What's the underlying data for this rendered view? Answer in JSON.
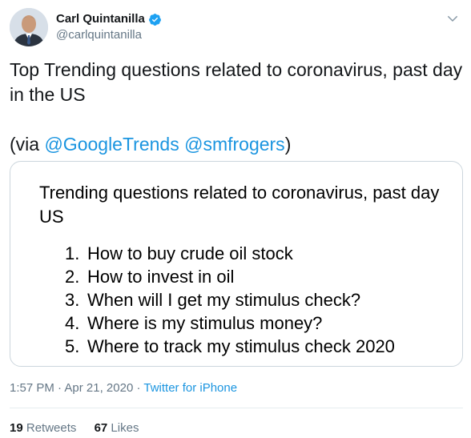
{
  "author": {
    "display_name": "Carl Quintanilla",
    "handle": "@carlquintanilla",
    "avatar_icon": "profile-photo",
    "verified_icon": "verified-badge-icon",
    "verified_color": "#1da1f2"
  },
  "tweet": {
    "text": "Top Trending questions related to coronavirus, past day in the US",
    "via_prefix": "(via ",
    "mention_1": "@GoogleTrends",
    "mention_2": "@smfrogers",
    "via_suffix": ")",
    "mention_color": "#1b95e0"
  },
  "card": {
    "title": "Trending questions related to coronavirus, past day US",
    "items": [
      {
        "num": "1.",
        "text": "How to buy crude oil stock"
      },
      {
        "num": "2.",
        "text": "How to invest in oil"
      },
      {
        "num": "3.",
        "text": "When will I get my stimulus check?"
      },
      {
        "num": "4.",
        "text": "Where is my stimulus money?"
      },
      {
        "num": "5.",
        "text": "Where to track my stimulus check 2020"
      }
    ]
  },
  "meta": {
    "time": "1:57 PM",
    "separator": " · ",
    "date": "Apr 21, 2020",
    "separator_2": " · ",
    "source": "Twitter for iPhone"
  },
  "stats": {
    "retweets_count": "19",
    "retweets_label": "Retweets",
    "likes_count": "67",
    "likes_label": "Likes"
  }
}
